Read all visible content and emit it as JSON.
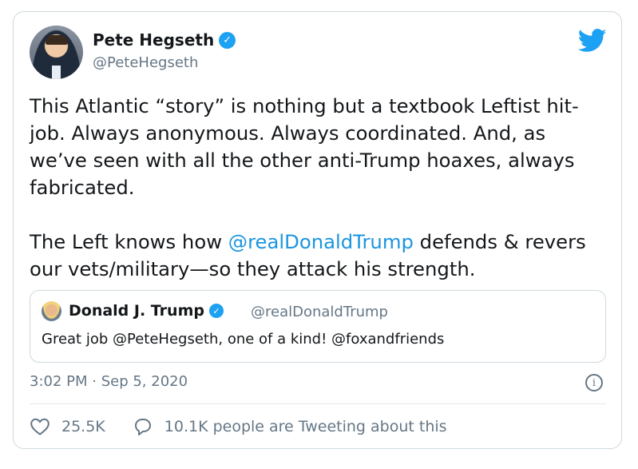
{
  "author": {
    "name": "Pete Hegseth",
    "handle": "@PeteHegseth"
  },
  "tweet": {
    "paragraph1": "This Atlantic “story” is nothing but a textbook Leftist hit-job. Always anonymous. Always coordinated. And, as we’ve seen with all the other anti-Trump hoaxes, always fabricated.",
    "paragraph2_before": "The Left knows how ",
    "paragraph2_mention": "@realDonaldTrump",
    "paragraph2_after": " defends & revers our vets/military—so they attack his strength."
  },
  "quoted": {
    "name": "Donald J. Trump",
    "handle": "@realDonaldTrump",
    "text": "Great job @PeteHegseth, one of a kind! @foxandfriends"
  },
  "meta": {
    "timestamp": "3:02 PM · Sep 5, 2020"
  },
  "actions": {
    "likes": "25.5K",
    "replies": "10.1K people are Tweeting about this"
  },
  "colors": {
    "brand_blue": "#1da1f2",
    "mention_blue": "#1b95e0",
    "secondary_text": "#657786",
    "border": "#cfd9de"
  },
  "icons": [
    "verified-badge-icon",
    "twitter-bird-icon",
    "info-icon",
    "heart-icon",
    "speech-bubble-icon"
  ]
}
